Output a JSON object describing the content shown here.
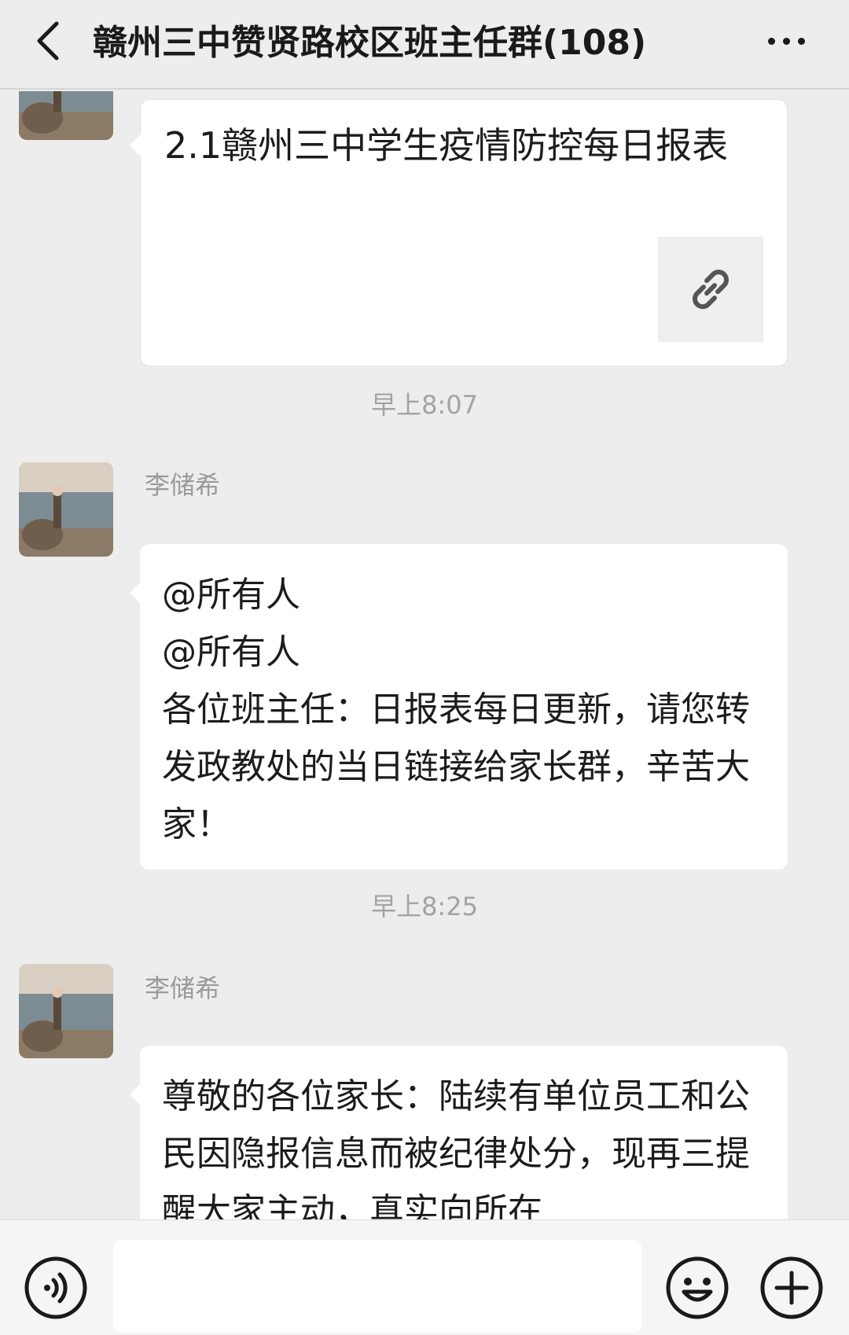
{
  "header": {
    "title": "赣州三中赞贤路校区班主任群(108)",
    "back_icon": "chevron-left-icon",
    "more_icon": "more-dots-icon"
  },
  "messages": [
    {
      "type": "link-card",
      "title": "2.1赣州三中学生疫情防控每日报表",
      "icon": "link-icon"
    },
    {
      "type": "time",
      "text": "早上8:07"
    },
    {
      "type": "text",
      "sender": "李储希",
      "text": "@所有人\n@所有人\n各位班主任：日报表每日更新，请您转发政教处的当日链接给家长群，辛苦大家！"
    },
    {
      "type": "time",
      "text": "早上8:25"
    },
    {
      "type": "text",
      "sender": "李储希",
      "text": "尊敬的各位家长：陆续有单位员工和公民因隐报信息而被纪律处分，现再三提醒大家主动，真实向所在"
    }
  ],
  "bottom_bar": {
    "voice_icon": "voice-icon",
    "input_value": "",
    "emoji_icon": "emoji-icon",
    "plus_icon": "plus-icon"
  },
  "colors": {
    "background": "#ededed",
    "bubble": "#ffffff",
    "meta_text": "#9a9a9a"
  }
}
